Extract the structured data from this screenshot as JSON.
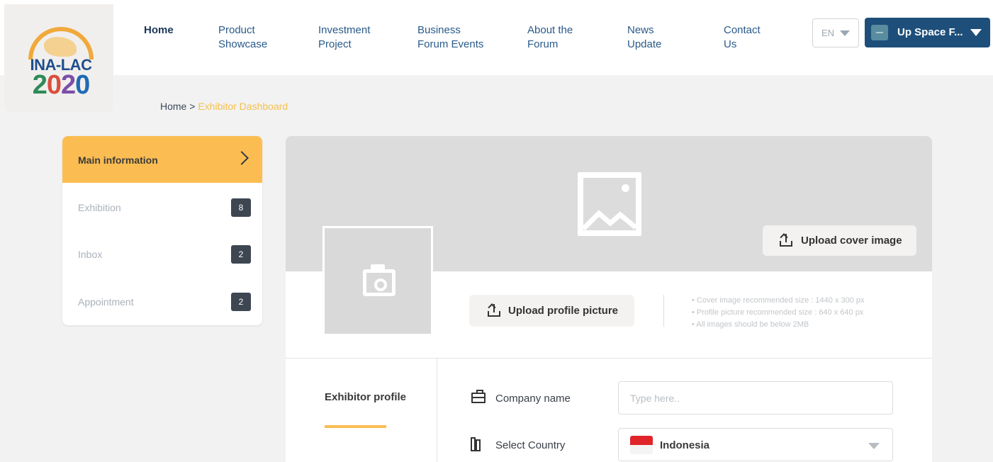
{
  "brand": {
    "logo_text": "INA-LAC",
    "logo_year": "2020"
  },
  "nav": [
    {
      "label": "Home",
      "active": true
    },
    {
      "label": "Product Showcase"
    },
    {
      "label": "Investment Project"
    },
    {
      "label": "Business Forum Events"
    },
    {
      "label": "About the Forum"
    },
    {
      "label": "News Update"
    },
    {
      "label": "Contact Us"
    }
  ],
  "language": {
    "value": "EN"
  },
  "user": {
    "name": "Up Space F..."
  },
  "breadcrumb": {
    "home": "Home",
    "separator": ">",
    "current": "Exhibitor Dashboard"
  },
  "sidebar": {
    "items": [
      {
        "label": "Main information",
        "active": true
      },
      {
        "label": "Exhibition",
        "badge": "8"
      },
      {
        "label": "Inbox",
        "badge": "2"
      },
      {
        "label": "Appointment",
        "badge": "2"
      }
    ]
  },
  "upload": {
    "cover_label": "Upload cover image",
    "profile_label": "Upload profile picture",
    "hints": [
      "• Cover image recommended size : 1440 x 300 px",
      "• Profile picture recommended size : 640 x 640 px",
      "• All images should be below 2MB"
    ]
  },
  "tabs": {
    "profile": "Exhibitor profile"
  },
  "form": {
    "company_label": "Company name",
    "company_placeholder": "Type here..",
    "country_label": "Select Country",
    "country_value": "Indonesia"
  },
  "colors": {
    "accent": "#fbbd52",
    "primary": "#1d4f7a",
    "breadcrumb_current": "#f4c14f"
  }
}
